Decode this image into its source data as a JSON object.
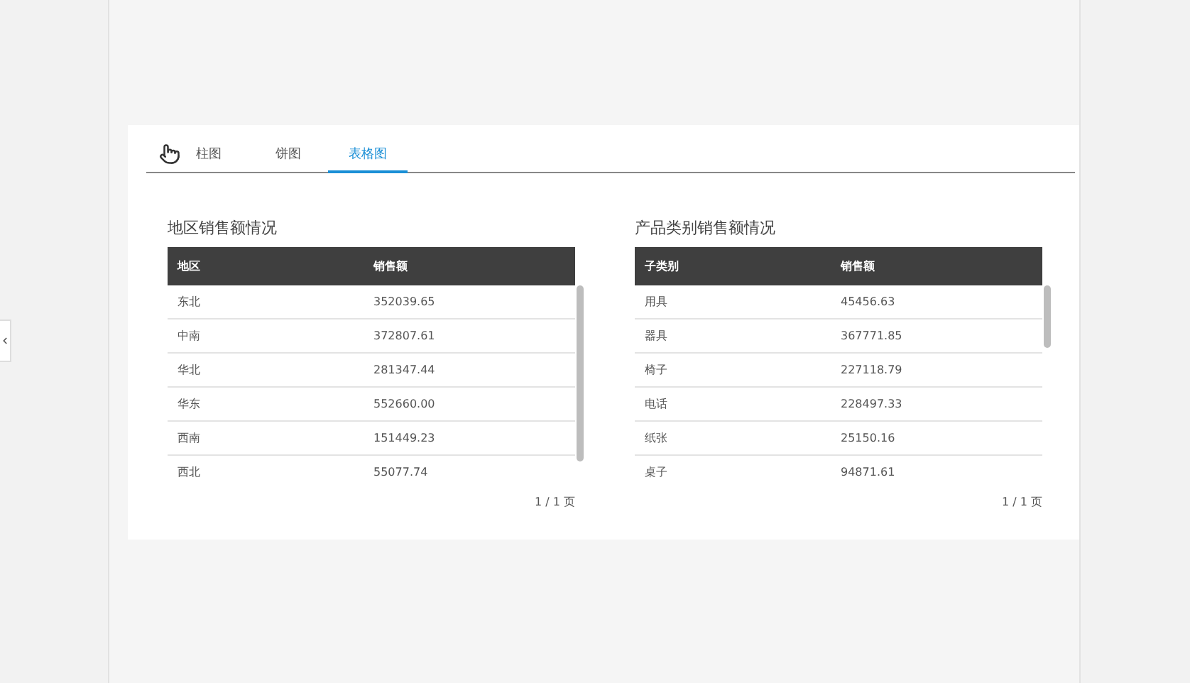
{
  "tabs": [
    {
      "label": "柱图",
      "selected": false
    },
    {
      "label": "饼图",
      "selected": false
    },
    {
      "label": "表格图",
      "selected": true
    }
  ],
  "tables": [
    {
      "title": "地区销售额情况",
      "columns": [
        "地区",
        "销售额"
      ],
      "rows": [
        [
          "东北",
          "352039.65"
        ],
        [
          "中南",
          "372807.61"
        ],
        [
          "华北",
          "281347.44"
        ],
        [
          "华东",
          "552660.00"
        ],
        [
          "西南",
          "151449.23"
        ],
        [
          "西北",
          "55077.74"
        ]
      ],
      "pagination": "1 / 1 页"
    },
    {
      "title": "产品类别销售额情况",
      "columns": [
        "子类别",
        "销售额"
      ],
      "rows": [
        [
          "用具",
          "45456.63"
        ],
        [
          "器具",
          "367771.85"
        ],
        [
          "椅子",
          "227118.79"
        ],
        [
          "电话",
          "228497.33"
        ],
        [
          "纸张",
          "25150.16"
        ],
        [
          "桌子",
          "94871.61"
        ]
      ],
      "pagination": "1 / 1 页"
    }
  ]
}
